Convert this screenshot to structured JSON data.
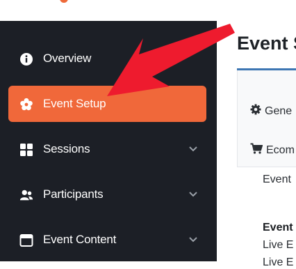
{
  "sidebar": {
    "items": [
      {
        "label": "Overview",
        "icon": "info-icon",
        "active": false,
        "chevron": false
      },
      {
        "label": "Event Setup",
        "icon": "settings-flower-icon",
        "active": true,
        "chevron": false
      },
      {
        "label": "Sessions",
        "icon": "grid-icon",
        "active": false,
        "chevron": true
      },
      {
        "label": "Participants",
        "icon": "users-icon",
        "active": false,
        "chevron": true
      },
      {
        "label": "Event Content",
        "icon": "window-icon",
        "active": false,
        "chevron": true
      }
    ]
  },
  "main": {
    "title": "Event S",
    "tabs": [
      {
        "label": "Gene",
        "icon": "gear-icon"
      },
      {
        "label": "Ecom",
        "icon": "cart-icon"
      }
    ],
    "lines": [
      {
        "text": "Event",
        "bold": false
      },
      {
        "text": "Event",
        "bold": true
      },
      {
        "text": "Live E",
        "bold": false
      },
      {
        "text": "Live E",
        "bold": false
      }
    ]
  },
  "colors": {
    "sidebar_bg": "#1c1f26",
    "active_item": "#f0683a",
    "arrow": "#ee1b2e",
    "tab_underline": "#3d76b3"
  }
}
